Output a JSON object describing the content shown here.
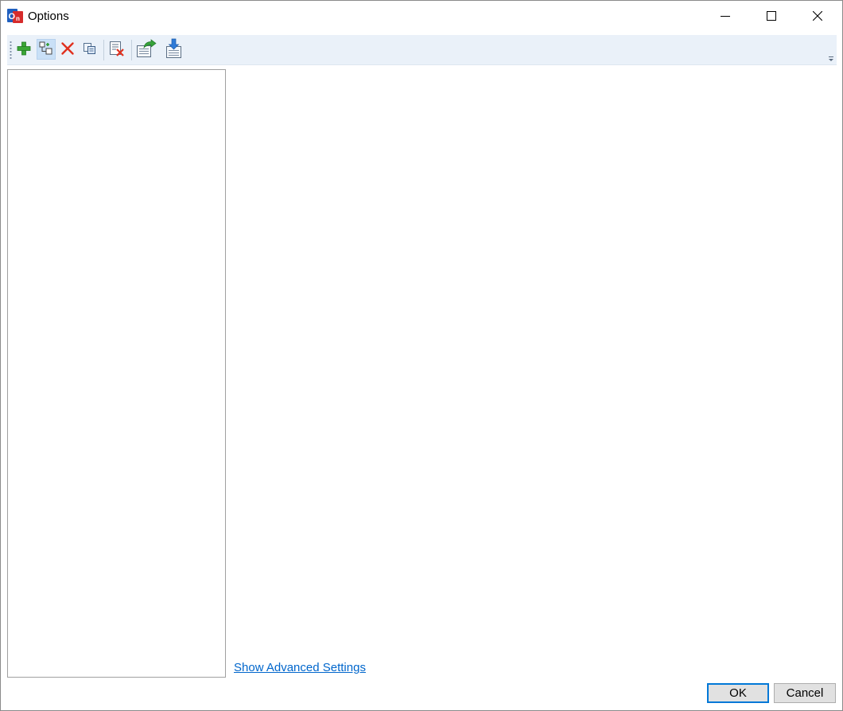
{
  "window": {
    "title": "Options",
    "app_icon": "app-logo-icon"
  },
  "window_controls": {
    "minimize_icon": "minimize-icon",
    "maximize_icon": "maximize-icon",
    "close_icon": "close-icon"
  },
  "toolbar": {
    "items": [
      {
        "name": "add-button",
        "icon": "green-plus-icon"
      },
      {
        "name": "add-child-button",
        "icon": "add-child-node-icon"
      },
      {
        "name": "delete-button",
        "icon": "red-x-icon"
      },
      {
        "name": "copy-button",
        "icon": "copy-icon"
      },
      {
        "name": "clear-button",
        "icon": "clear-list-icon"
      },
      {
        "name": "export-button",
        "icon": "export-icon"
      },
      {
        "name": "import-button",
        "icon": "import-icon"
      }
    ],
    "overflow_icon": "toolbar-overflow-icon"
  },
  "main": {
    "advanced_link": "Show Advanced Settings"
  },
  "buttons": {
    "ok": "OK",
    "cancel": "Cancel"
  },
  "colors": {
    "toolbar_bg": "#eaf1f9",
    "link": "#0066cc",
    "default_button_border": "#0078d7"
  }
}
